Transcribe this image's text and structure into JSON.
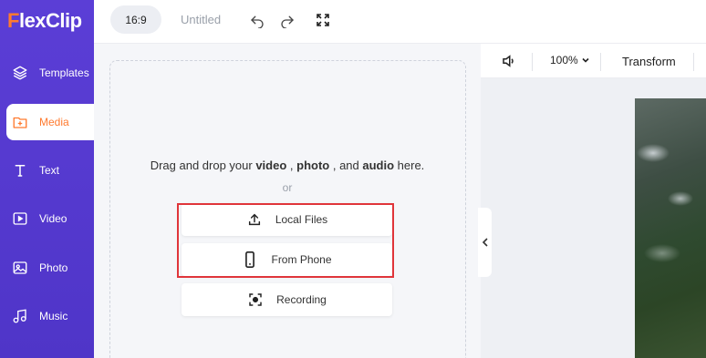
{
  "app": {
    "logo_text_f": "F",
    "logo_text_rest": "lexClip"
  },
  "sidebar": {
    "items": [
      {
        "label": "Templates",
        "icon": "layers-icon",
        "active": false
      },
      {
        "label": "Media",
        "icon": "folder-plus-icon",
        "active": true
      },
      {
        "label": "Text",
        "icon": "text-t-icon",
        "active": false
      },
      {
        "label": "Video",
        "icon": "video-play-icon",
        "active": false
      },
      {
        "label": "Photo",
        "icon": "image-icon",
        "active": false
      },
      {
        "label": "Music",
        "icon": "music-note-icon",
        "active": false
      }
    ]
  },
  "topbar": {
    "aspect_ratio": "16:9",
    "project_title": "Untitled"
  },
  "media_panel": {
    "drop_prefix": "Drag and drop your ",
    "drop_video": "video",
    "drop_sep1": " , ",
    "drop_photo": "photo",
    "drop_sep2": " , and ",
    "drop_audio": "audio",
    "drop_suffix": " here.",
    "or": "or",
    "buttons": [
      {
        "label": "Local Files",
        "icon": "upload-icon"
      },
      {
        "label": "From Phone",
        "icon": "phone-icon"
      },
      {
        "label": "Recording",
        "icon": "record-icon"
      }
    ]
  },
  "canvas_toolbar": {
    "zoom": "100%",
    "transform_label": "Transform"
  },
  "colors": {
    "sidebar": "#5b3ed6",
    "accent": "#ff7a2f",
    "highlight": "#e0353a"
  }
}
